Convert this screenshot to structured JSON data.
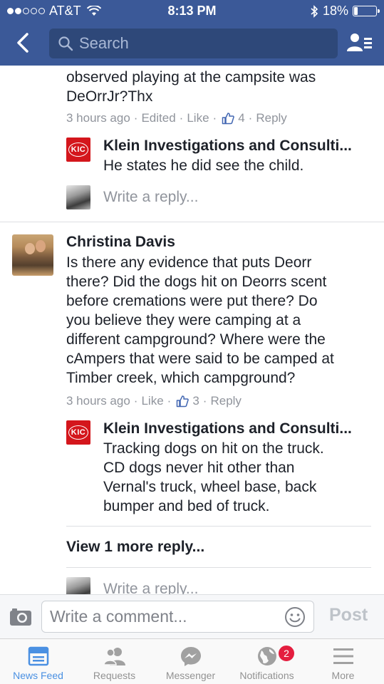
{
  "status_bar": {
    "carrier": "AT&T",
    "time": "8:13 PM",
    "battery": "18%",
    "battery_level": 0.18,
    "signal_bars": 2
  },
  "header": {
    "search_placeholder": "Search",
    "back_icon": "chevron-left-icon",
    "friends_icon": "friend-requests-icon",
    "brand_color": "#3b5998"
  },
  "thread": {
    "top_reply": {
      "text_line1": "observed playing at the campsite was",
      "text_line2": "DeOrrJr?Thx",
      "time": "3 hours ago",
      "edited": "Edited",
      "like": "Like",
      "like_count": "4",
      "reply": "Reply"
    },
    "top_sub_reply": {
      "author": "Klein Investigations and Consulti...",
      "text": "He states he did see the child.",
      "avatar_text": "KIC"
    },
    "write_reply_1": "Write a reply...",
    "comment": {
      "author": "Christina Davis",
      "lines": [
        "Is there any evidence that puts Deorr",
        "there?  Did the dogs hit on Deorrs scent",
        "before cremations were put there? Do",
        "you believe they were camping at a",
        "different campground? Where were the",
        "cAmpers that were said to be camped at",
        "Timber creek, which campground?"
      ],
      "time": "3 hours ago",
      "like": "Like",
      "like_count": "3",
      "reply": "Reply"
    },
    "comment_sub_reply": {
      "author": "Klein Investigations and Consulti...",
      "avatar_text": "KIC",
      "lines": [
        "Tracking dogs on hit on the truck.",
        "CD dogs never hit other than",
        "Vernal's truck, wheel base, back",
        "bumper and bed of truck."
      ]
    },
    "view_more": "View 1 more reply...",
    "write_reply_2": "Write a reply..."
  },
  "composer": {
    "placeholder": "Write a comment...",
    "post_label": "Post"
  },
  "tabbar": {
    "tabs": [
      {
        "label": "News Feed",
        "icon": "news-feed-icon",
        "active": true
      },
      {
        "label": "Requests",
        "icon": "requests-icon",
        "active": false
      },
      {
        "label": "Messenger",
        "icon": "messenger-icon",
        "active": false
      },
      {
        "label": "Notifications",
        "icon": "globe-icon",
        "active": false
      },
      {
        "label": "More",
        "icon": "menu-icon",
        "active": false
      }
    ],
    "notifications_badge": "2"
  }
}
